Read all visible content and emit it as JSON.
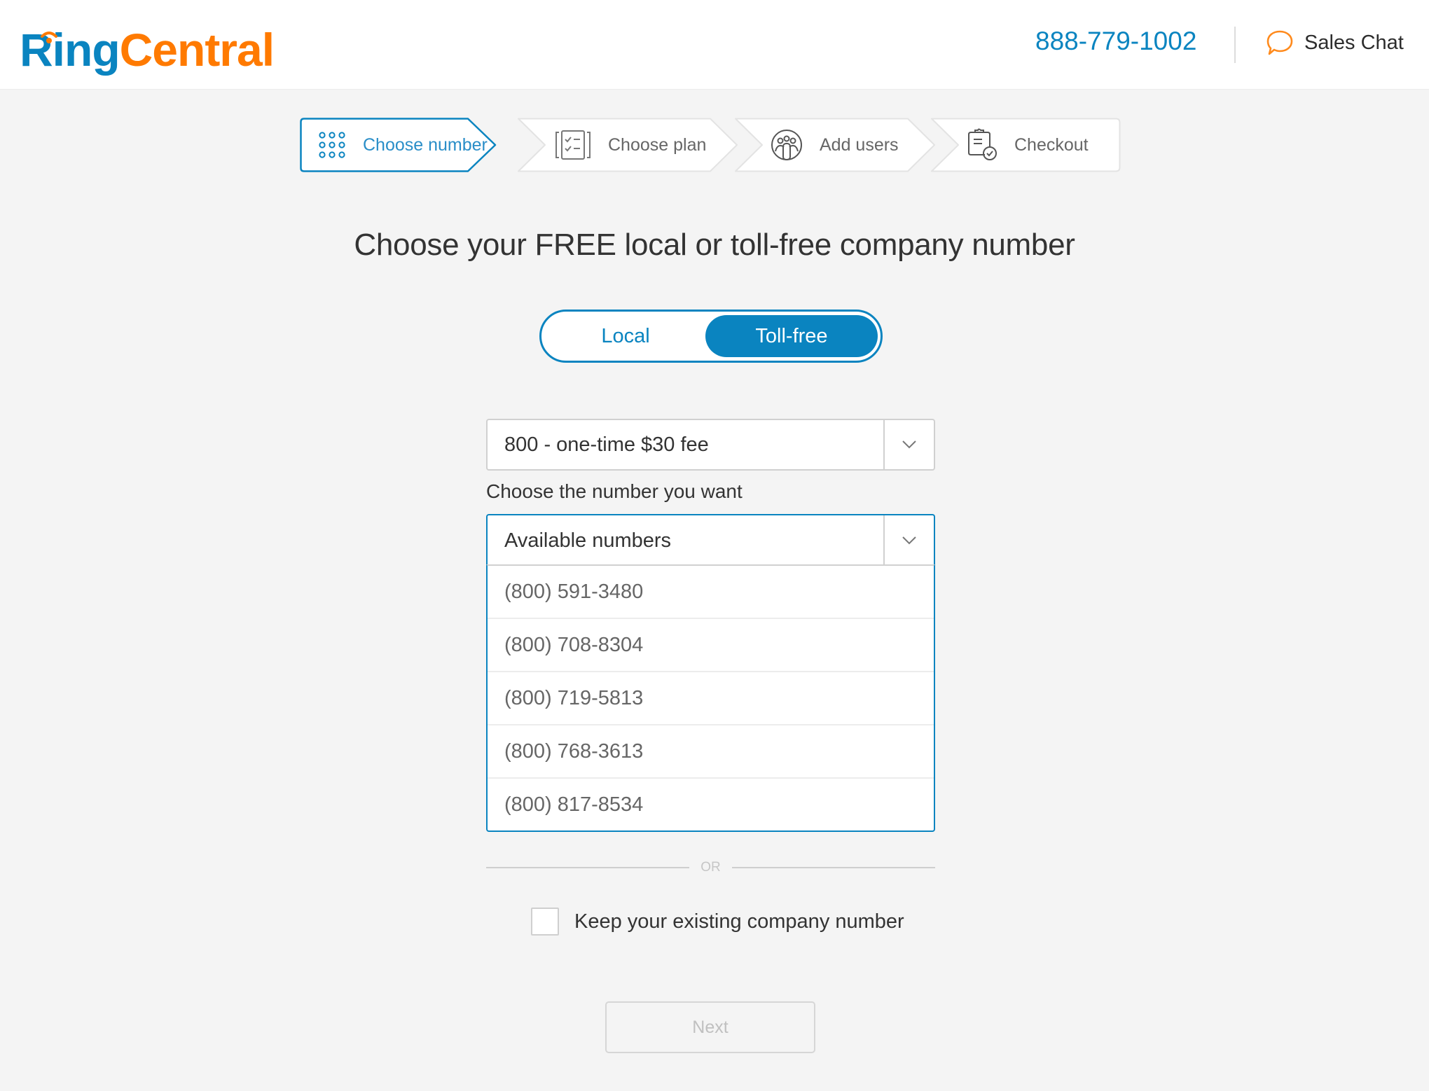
{
  "header": {
    "logo": {
      "part1": "Ring",
      "part2": "Central"
    },
    "phone": "888-779-1002",
    "sales_chat": "Sales Chat"
  },
  "stepper": {
    "steps": [
      {
        "label": "Choose number",
        "icon": "keypad-icon",
        "active": true
      },
      {
        "label": "Choose plan",
        "icon": "checklist-icon",
        "active": false
      },
      {
        "label": "Add users",
        "icon": "users-icon",
        "active": false
      },
      {
        "label": "Checkout",
        "icon": "clipboard-check-icon",
        "active": false
      }
    ]
  },
  "main": {
    "title": "Choose your FREE local or toll-free company number",
    "toggle": {
      "options": [
        "Local",
        "Toll-free"
      ],
      "selected": "Toll-free"
    },
    "prefix_select": {
      "value": "800 - one-time $30 fee"
    },
    "number_label": "Choose the number you want",
    "number_select": {
      "placeholder": "Available numbers",
      "options": [
        "(800) 591-3480",
        "(800) 708-8304",
        "(800) 719-5813",
        "(800) 768-3613",
        "(800) 817-8534"
      ]
    },
    "or_label": "OR",
    "keep_existing": {
      "label": "Keep your existing company number",
      "checked": false
    },
    "next_button": {
      "label": "Next",
      "disabled": true
    }
  },
  "colors": {
    "brand_blue": "#0a84c0",
    "brand_orange": "#ff7a00",
    "background": "#f4f4f4"
  }
}
